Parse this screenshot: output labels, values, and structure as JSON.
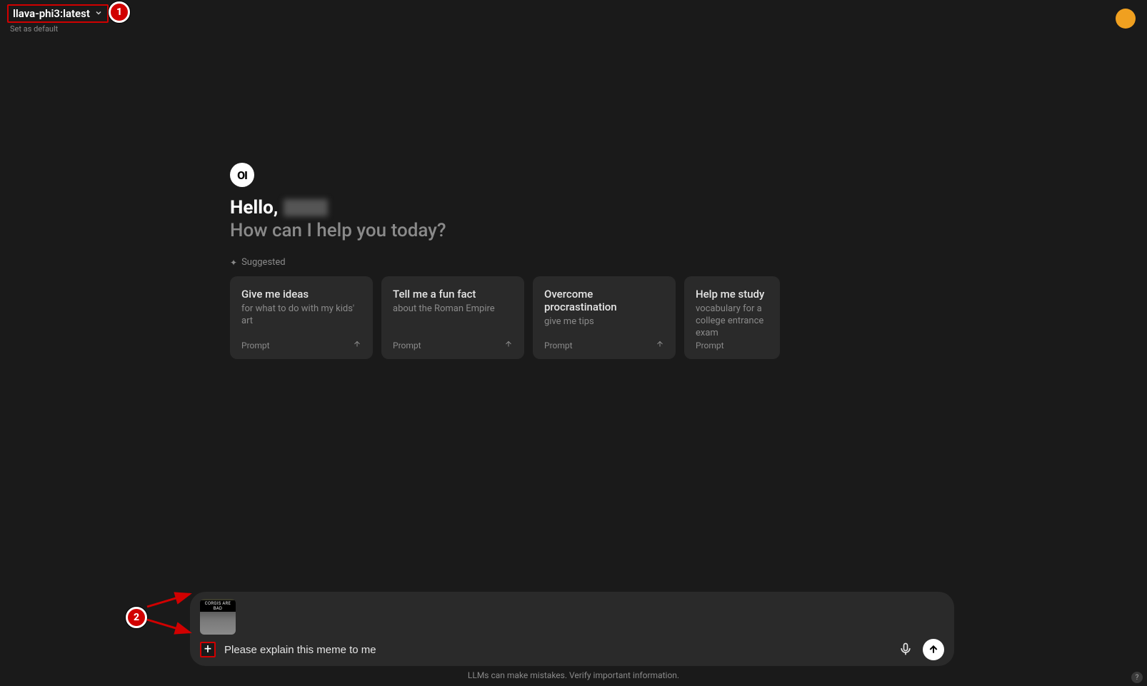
{
  "header": {
    "model": "llava-phi3:latest",
    "set_default": "Set as default"
  },
  "greeting": {
    "hello": "Hello,",
    "sub": "How can I help you today?"
  },
  "suggested": {
    "label": "Suggested",
    "prompt_label": "Prompt",
    "cards": [
      {
        "title": "Give me ideas",
        "sub": "for what to do with my kids' art"
      },
      {
        "title": "Tell me a fun fact",
        "sub": "about the Roman Empire"
      },
      {
        "title": "Overcome procrastination",
        "sub": "give me tips"
      },
      {
        "title": "Help me study",
        "sub": "vocabulary for a college entrance exam"
      }
    ]
  },
  "input": {
    "attachment_caption": "CORGIS ARE BAD",
    "text": "Please explain this meme to me"
  },
  "disclaimer": "LLMs can make mistakes. Verify important information.",
  "annotations": {
    "callout1": "1",
    "callout2": "2"
  },
  "help": "?"
}
